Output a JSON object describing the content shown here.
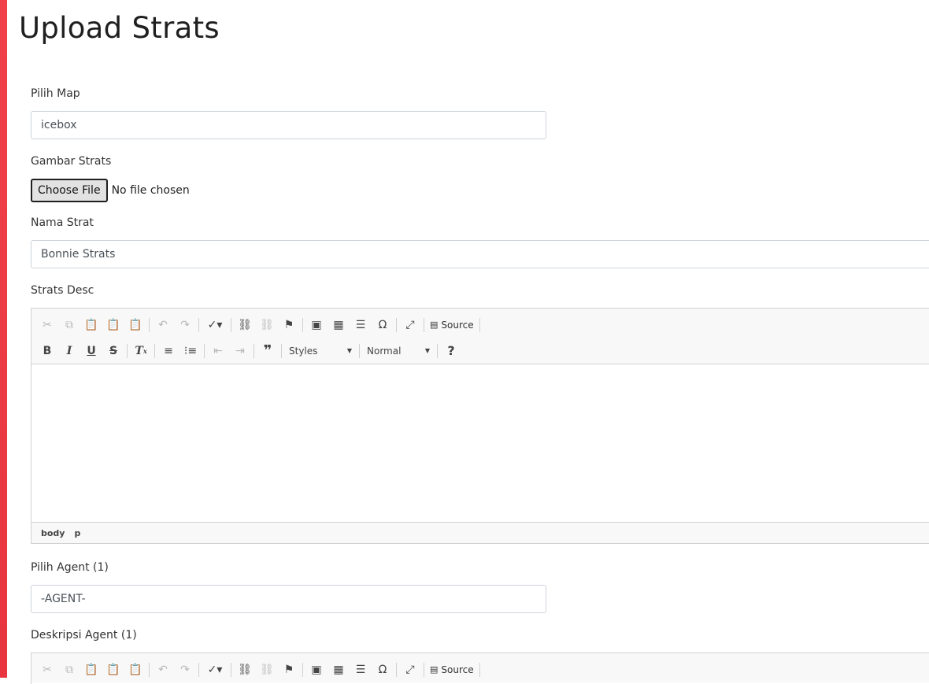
{
  "page": {
    "title": "Upload Strats",
    "accent_color": "#f0414a"
  },
  "form": {
    "map": {
      "label": "Pilih Map",
      "value": "icebox"
    },
    "image": {
      "label": "Gambar Strats",
      "button": "Choose File",
      "status": "No file chosen"
    },
    "name": {
      "label": "Nama Strat",
      "value": "Bonnie Strats"
    },
    "desc": {
      "label": "Strats Desc"
    },
    "agent": {
      "label": "Pilih Agent (1)",
      "value": "-AGENT-"
    },
    "agent_desc": {
      "label": "Deskripsi Agent (1)"
    }
  },
  "editor": {
    "source_label": "Source",
    "styles_label": "Styles",
    "format_label": "Normal",
    "help_label": "?",
    "path": [
      "body",
      "p"
    ],
    "icons_row1": [
      "cut-icon",
      "copy-icon",
      "paste-icon",
      "paste-text-icon",
      "paste-word-icon",
      "undo-icon",
      "redo-icon",
      "spellcheck-icon",
      "link-icon",
      "unlink-icon",
      "anchor-icon",
      "image-icon",
      "table-icon",
      "horizontal-line-icon",
      "special-char-icon",
      "maximize-icon",
      "source-icon"
    ],
    "icons_row2": [
      "bold-icon",
      "italic-icon",
      "underline-icon",
      "strike-icon",
      "remove-format-icon",
      "numbered-list-icon",
      "bulleted-list-icon",
      "outdent-icon",
      "indent-icon",
      "blockquote-icon",
      "help-icon"
    ]
  }
}
